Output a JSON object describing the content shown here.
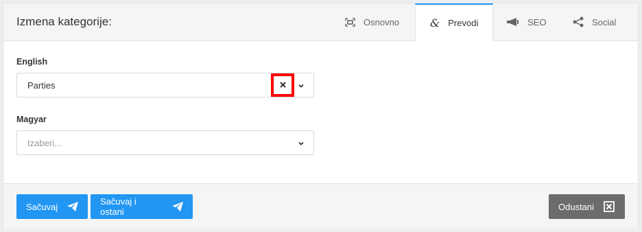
{
  "header": {
    "title": "Izmena kategorije:",
    "tabs": [
      {
        "label": "Osnovno",
        "icon": "frame-icon",
        "active": false
      },
      {
        "label": "Prevodi",
        "icon": "ampersand-icon",
        "active": true
      },
      {
        "label": "SEO",
        "icon": "megaphone-icon",
        "active": false
      },
      {
        "label": "Social",
        "icon": "share-icon",
        "active": false
      }
    ]
  },
  "fields": {
    "english": {
      "label": "English",
      "value": "Parties"
    },
    "magyar": {
      "label": "Magyar",
      "placeholder": "Izaberi..."
    }
  },
  "footer": {
    "save_label": "Sačuvaj",
    "save_stay_label": "Sačuvaj i ostani",
    "cancel_label": "Odustani"
  },
  "colors": {
    "primary": "#2196f3",
    "cancel": "#6c6c6c",
    "highlight": "#ff0000"
  }
}
